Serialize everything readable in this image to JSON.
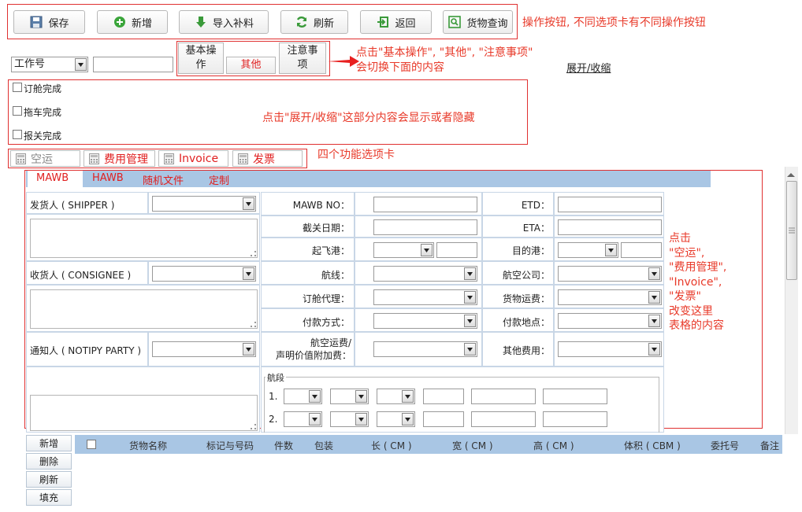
{
  "toolbar": {
    "save": "保存",
    "add": "新增",
    "import": "导入补料",
    "refresh": "刷新",
    "back": "返回",
    "cargo_query": "货物查询"
  },
  "notes": {
    "toolbar": "操作按钮, 不同选项卡有不同操作按钮",
    "tabs_line1": "点击\"基本操作\", \"其他\", \"注意事项\"",
    "tabs_line2": "会切换下面的内容",
    "collapse": "点击\"展开/收缩\"这部分内容会显示或者隐藏",
    "func_tabs": "四个功能选项卡",
    "side_lines": [
      "点击",
      "\"空运\",",
      "\"费用管理\",",
      "\"Invoice\",",
      "\"发票\"",
      "改变这里",
      "表格的内容"
    ]
  },
  "search": {
    "field": "工作号",
    "value": ""
  },
  "view_tabs": {
    "basic_1": "基本操",
    "basic_2": "作",
    "other": "其他",
    "notice_1": "注意事",
    "notice_2": "项"
  },
  "expand_toggle": "展开/收缩",
  "status_checks": [
    "订舱完成",
    "拖车完成",
    "报关完成"
  ],
  "func_tabs": [
    "空运",
    "费用管理",
    "Invoice",
    "发票"
  ],
  "sub_tabs": [
    "MAWB",
    "HAWB",
    "随机文件",
    "定制"
  ],
  "form": {
    "shipper": "发货人 ( SHIPPER )",
    "consignee": "收货人 ( CONSIGNEE )",
    "notify": "通知人 ( NOTIPY PARTY )",
    "mawb_no": "MAWB NO：",
    "cutoff": "截关日期：",
    "departure": "起飞港：",
    "route": "航线：",
    "booking_agent": "订舱代理：",
    "payment_method": "付款方式：",
    "freight_1": "航空运费/",
    "freight_2": "声明价值附加费：",
    "etd": "ETD：",
    "eta": "ETA：",
    "destination": "目的港：",
    "airline": "航空公司：",
    "cargo_freight": "货物运费：",
    "payment_place": "付款地点：",
    "other_fees": "其他费用：",
    "segment_legend": "航段",
    "segment_rows": [
      "1.",
      "2."
    ]
  },
  "grid": {
    "headers": [
      "货物名称",
      "标记与号码",
      "件数",
      "包装",
      "长 ( CM )",
      "宽 ( CM )",
      "高 ( CM )",
      "体积 ( CBM )",
      "委托号",
      "备注"
    ]
  },
  "grid_buttons": [
    "新增",
    "删除",
    "刷新",
    "填充"
  ]
}
